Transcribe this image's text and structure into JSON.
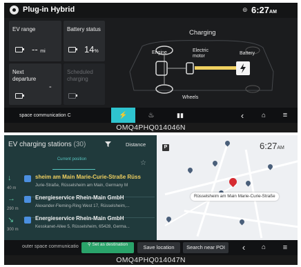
{
  "screen1": {
    "title": "Plug-in Hybrid",
    "clock": "6:27",
    "clock_suffix": "AM",
    "tiles": {
      "ev_range_label": "EV range",
      "ev_range_value": "--",
      "ev_range_unit": "mi",
      "battery_label": "Battery status",
      "battery_value": "14",
      "battery_unit": "%",
      "next_departure_label": "Next departure",
      "next_departure_value": "-",
      "scheduled_label": "Scheduled charging"
    },
    "diagram": {
      "status": "Charging",
      "engine": "Engine",
      "electric_motor": "Electric motor",
      "battery": "Battery",
      "wheels": "Wheels"
    },
    "bottom_nav": {
      "left_text": "space communication",
      "left_suffix": "C"
    }
  },
  "caption1": "OMQ4PHQ014046N",
  "screen2": {
    "panel": {
      "title": "EV charging stations",
      "count": "(30)",
      "sort_label": "Distance",
      "current_position": "Current position"
    },
    "stations": [
      {
        "arrow": "↓",
        "distance": "40 m",
        "name": "sheim am Main Marie-Curie-Straße  Rüss",
        "address": "Jurie-Straße, Rüsselsheim am Main, Germany  M"
      },
      {
        "arrow": "→",
        "distance": "290 m",
        "name": "Energieservice Rhein-Main GmbH",
        "address": "Alexander-Fleming-Ring West 17, Rüsselsheim,..."
      },
      {
        "arrow": "↘",
        "distance": "300 m",
        "name": "Energieservice Rhein-Main GmbH",
        "address": "Kesskanet-Allee 5, Rüsselsheim, 65428, Germa..."
      }
    ],
    "clock": "6:27",
    "clock_suffix": "AM",
    "map_label": "Rüsselsheim am Main Marie-Curie-Straße",
    "bottom": {
      "left_text": "outer space communicatio",
      "set_destination": "Set as destination",
      "save_location": "Save location",
      "search_near_poi": "Search near POI"
    }
  },
  "caption2": "OMQ4PHQ014047N",
  "colors": {
    "accent": "#2ec4cf",
    "panel_bg": "#203a3c",
    "pin_red": "#d62b31",
    "charge_bar": "#f0d060"
  }
}
